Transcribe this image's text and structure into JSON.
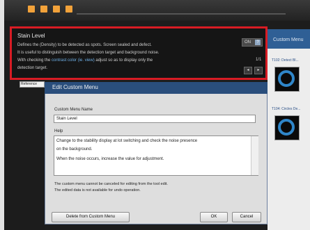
{
  "tooltip": {
    "title": "Stain Level",
    "lines": [
      "Defines the (Density) to be detected as spots. Screen sealed and defect.",
      "It is useful to distinguish between the detection target and background noise."
    ],
    "line3_prefix": "With checking the ",
    "line3_link": "contrast color (ie. view)",
    "line3_suffix": " adjust so as to display only the",
    "line4": "detection target.",
    "toggle_label": "ON",
    "help_glyph": "?",
    "page": "1/1",
    "prev": "◂",
    "next": "▸"
  },
  "right_panel": {
    "title": "Custom Menu",
    "item1_caption": "T102: Detect Bl...",
    "item2_caption": "T104: Circles De..."
  },
  "left_strip": {
    "tab_label": "Reference"
  },
  "dialog": {
    "title": "Edit Custom Menu",
    "name_label": "Custom Menu Name",
    "name_value": "Stain Level",
    "help_label": "Help",
    "help_lines": [
      "Change to the stability display at lot switching and check the noise presence",
      "  on the background.",
      "When the noise occurs, increase the value for adjustment."
    ],
    "notes": [
      "The custom menu cannot be canceled for editing from the tool edit.",
      "The edited data is not available for undo operation."
    ],
    "delete_label": "Delete from Custom Menu",
    "ok_label": "OK",
    "cancel_label": "Cancel"
  },
  "colors": {
    "tooltip_border": "#d81c24",
    "dialog_titlebar": "#2a4e7c",
    "link": "#6fb0e6",
    "accent_orange": "#f2a23a"
  }
}
